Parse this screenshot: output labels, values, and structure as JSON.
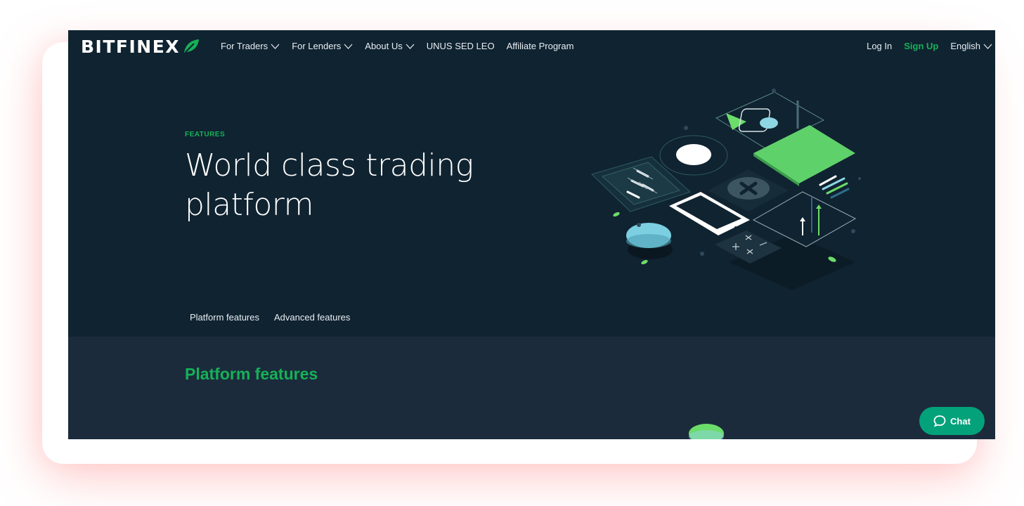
{
  "brand": {
    "name": "BITFINEX",
    "leaf_color": "#16b157"
  },
  "nav": {
    "menu": [
      {
        "label": "For Traders",
        "has_dropdown": true,
        "icon": "chevron-down-icon"
      },
      {
        "label": "For Lenders",
        "has_dropdown": true,
        "icon": "chevron-down-icon"
      },
      {
        "label": "About Us",
        "has_dropdown": true,
        "icon": "chevron-down-icon"
      },
      {
        "label": "UNUS SED LEO",
        "has_dropdown": false
      },
      {
        "label": "Affiliate Program",
        "has_dropdown": false
      }
    ],
    "login": "Log In",
    "signup": "Sign Up",
    "language": "English"
  },
  "hero": {
    "eyebrow": "FEATURES",
    "title": "World class trading platform"
  },
  "subnav": {
    "items": [
      "Platform features",
      "Advanced features"
    ]
  },
  "section": {
    "title": "Platform features"
  },
  "chat": {
    "label": "Chat",
    "icon": "chat-bubble-icon"
  },
  "colors": {
    "background": "#102331",
    "section_background": "#1b2b3c",
    "accent_green": "#16b157",
    "chat_button": "#03a27b"
  }
}
